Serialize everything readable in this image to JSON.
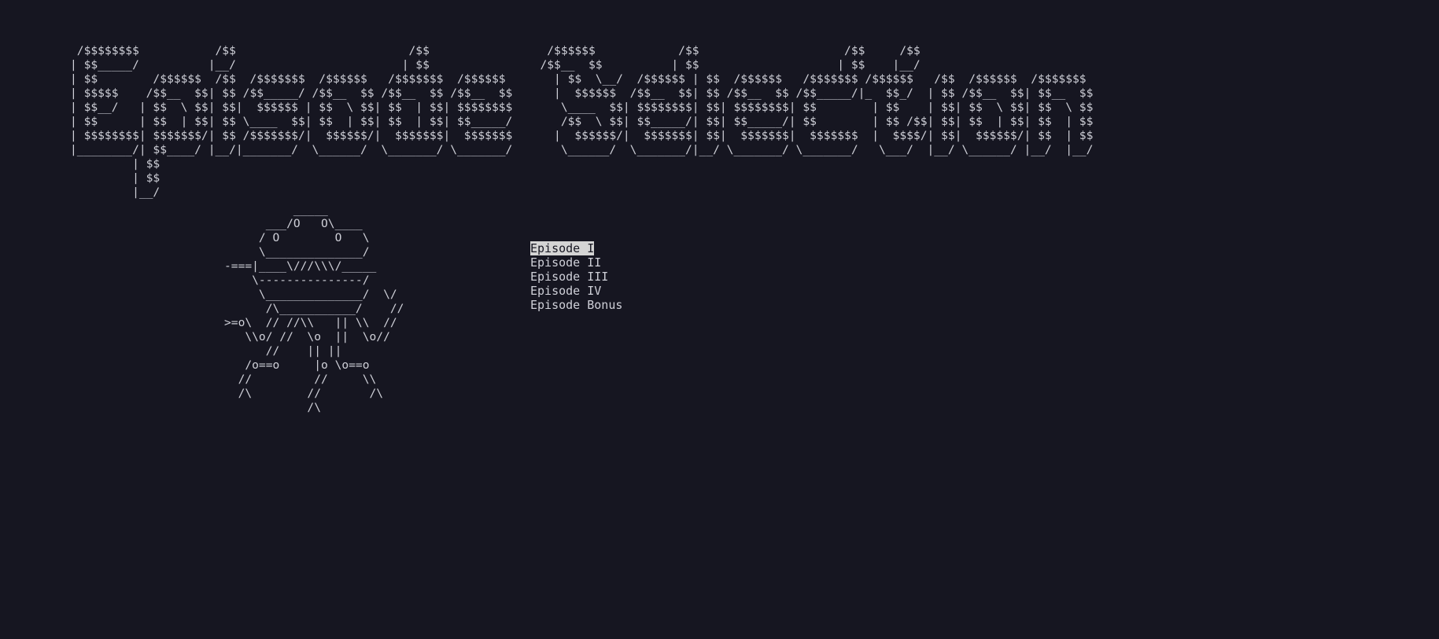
{
  "terminal": {
    "banner_ascii": " /$$$$$$$$           /$$                         /$$                 /$$$$$$            /$$                     /$$     /$$\n| $$_____/          |__/                        | $$                /$$__  $$          | $$                    | $$    |__/\n| $$        /$$$$$$  /$$  /$$$$$$$  /$$$$$$   /$$$$$$$  /$$$$$$       | $$  \\__/  /$$$$$$ | $$  /$$$$$$   /$$$$$$$ /$$$$$$   /$$  /$$$$$$  /$$$$$$$\n| $$$$$    /$$__  $$| $$ /$$_____/ /$$__  $$ /$$__  $$ /$$__  $$      |  $$$$$$  /$$__  $$| $$ /$$__  $$ /$$_____/|_  $$_/  | $$ /$$__  $$| $$__  $$\n| $$__/   | $$  \\ $$| $$|  $$$$$$ | $$  \\ $$| $$  | $$| $$$$$$$$       \\____  $$| $$$$$$$$| $$| $$$$$$$$| $$        | $$    | $$| $$  \\ $$| $$  \\ $$\n| $$      | $$  | $$| $$ \\____  $$| $$  | $$| $$  | $$| $$_____/       /$$  \\ $$| $$_____/| $$| $$_____/| $$        | $$ /$$| $$| $$  | $$| $$  | $$\n| $$$$$$$$| $$$$$$$/| $$ /$$$$$$$/|  $$$$$$/|  $$$$$$$|  $$$$$$$      |  $$$$$$/|  $$$$$$$| $$|  $$$$$$$|  $$$$$$$  |  $$$$/| $$|  $$$$$$/| $$  | $$\n|________/| $$____/ |__/|_______/  \\______/  \\_______/ \\_______/       \\______/  \\_______/|__/ \\_______/ \\_______/   \\___/  |__/ \\______/ |__/  |__/\n         | $$\n         | $$\n         |__/",
    "robot_ascii": "          _____\n      ___/O   O\\____\n     / O        O   \\\n     \\______________/\n-===|____\\///\\\\\\/_____\n    \\---------------/\n     \\______________/  \\/\n      /\\___________/    //\n>=o\\  // //\\\\   || \\\\  //\n   \\\\o/ //  \\o  ||  \\o//\n      //    || ||\n   /o==o     |o \\o==o\n  //         //     \\\\\n  /\\        //       /\\\n            /\\",
    "menu_items": [
      "Episode I",
      "Episode II",
      "Episode III",
      "Episode IV",
      "Episode Bonus"
    ],
    "selected_index": 0
  },
  "colors": {
    "background": "#161621",
    "foreground": "#cfd0d8",
    "highlight_background": "#d4d4d4",
    "highlight_foreground": "#161621"
  }
}
